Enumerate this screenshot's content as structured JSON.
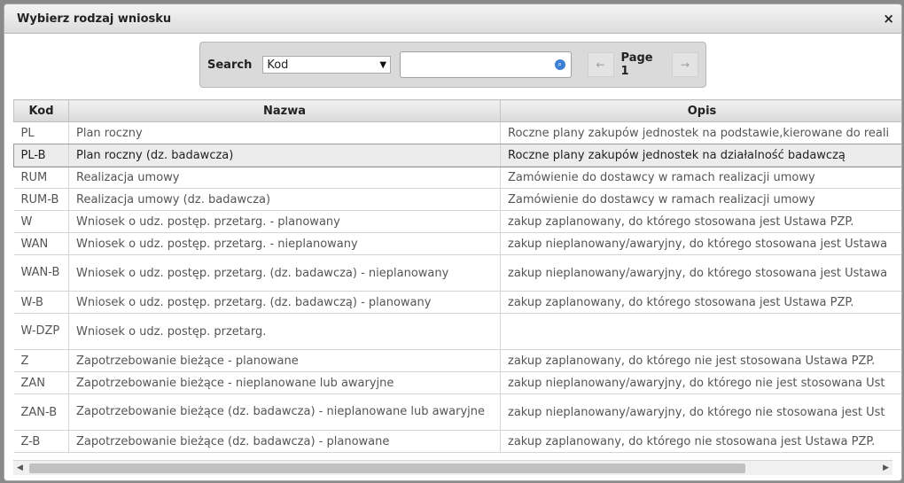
{
  "dialog": {
    "title": "Wybierz rodzaj wniosku",
    "close_glyph": "×"
  },
  "search": {
    "label": "Search",
    "field_selected": "Kod",
    "query_value": "",
    "prev_glyph": "←",
    "page_label": "Page 1",
    "next_glyph": "→"
  },
  "table": {
    "headers": [
      "Kod",
      "Nazwa",
      "Opis"
    ],
    "rows": [
      {
        "kod": "PL",
        "nazwa": "Plan roczny",
        "opis": "Roczne plany zakupów jednostek na podstawie,kierowane do reali"
      },
      {
        "kod": "PL-B",
        "nazwa": "Plan roczny (dz. badawcza)",
        "opis": "Roczne plany zakupów jednostek na działalność badawczą"
      },
      {
        "kod": "RUM",
        "nazwa": "Realizacja umowy",
        "opis": "Zamówienie do dostawcy w ramach realizacji umowy"
      },
      {
        "kod": "RUM-B",
        "nazwa": "Realizacja umowy (dz. badawcza)",
        "opis": "Zamówienie do dostawcy w ramach realizacji umowy"
      },
      {
        "kod": "W",
        "nazwa": "Wniosek o udz. postęp. przetarg. - planowany",
        "opis": "zakup zaplanowany, do którego stosowana jest Ustawa PZP."
      },
      {
        "kod": "WAN",
        "nazwa": "Wniosek o udz. postęp. przetarg. - nieplanowany",
        "opis": "zakup nieplanowany/awaryjny, do którego stosowana jest Ustawa"
      },
      {
        "kod": "WAN-B",
        "nazwa": "Wniosek o udz. postęp. przetarg. (dz. badawcza) - nieplanowany",
        "opis": "zakup nieplanowany/awaryjny, do którego stosowana jest Ustawa"
      },
      {
        "kod": "W-B",
        "nazwa": "Wniosek o udz. postęp. przetarg. (dz. badawczą) - planowany",
        "opis": "zakup zaplanowany, do którego stosowana jest Ustawa PZP."
      },
      {
        "kod": "W-DZP",
        "nazwa": "Wniosek o udz. postęp. przetarg.",
        "opis": ""
      },
      {
        "kod": "Z",
        "nazwa": "Zapotrzebowanie bieżące - planowane",
        "opis": "zakup zaplanowany, do którego nie jest stosowana Ustawa PZP."
      },
      {
        "kod": "ZAN",
        "nazwa": "Zapotrzebowanie bieżące - nieplanowane lub awaryjne",
        "opis": "zakup nieplanowany/awaryjny, do którego nie jest stosowana Ust"
      },
      {
        "kod": "ZAN-B",
        "nazwa": "Zapotrzebowanie bieżące (dz. badawcza) - nieplanowane lub awaryjne",
        "opis": "zakup nieplanowany/awaryjny, do którego nie stosowana jest Ust"
      },
      {
        "kod": "Z-B",
        "nazwa": "Zapotrzebowanie bieżące (dz. badawcza) - planowane",
        "opis": "zakup zaplanowany, do którego nie stosowana jest Ustawa PZP."
      }
    ]
  },
  "scrollbar": {
    "left_glyph": "◀",
    "right_glyph": "▶"
  }
}
